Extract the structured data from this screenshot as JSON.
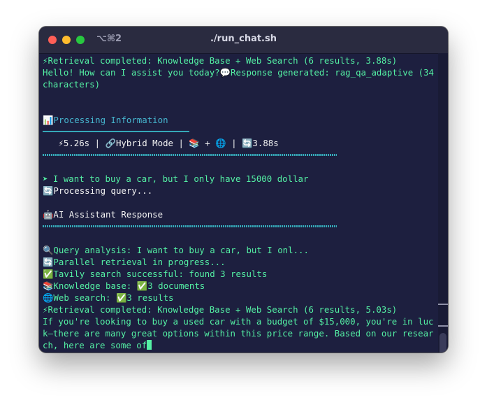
{
  "window": {
    "shortcut": "⌥⌘2",
    "title": "./run_chat.sh"
  },
  "terminal": {
    "line1": "⚡Retrieval completed: Knowledge Base + Web Search (6 results, 3.88s)",
    "line2": "Hello! How can I assist you today?💬Response generated: rag_qa_adaptive (34 characters)",
    "processing_header": "📊Processing Information",
    "stats_line": "   ⚡5.26s | 🔗Hybrid Mode | 📚 + 🌐 | 🔄3.88s",
    "prompt_line": "➤ I want to buy a car, but I only have 15000 dollar",
    "processing_query": "🔄Processing query...",
    "assistant_header": "🤖AI Assistant Response",
    "query_analysis": "🔍Query analysis: I want to buy a car, but I onl...",
    "parallel": "🔄Parallel retrieval in progress...",
    "tavily": "✅Tavily search successful: found 3 results",
    "kb": "📚Knowledge base: ✅3 documents",
    "web": "🌐Web search: ✅3 results",
    "retrieval2": "⚡Retrieval completed: Knowledge Base + Web Search (6 results, 5.03s)",
    "response": "If you're looking to buy a used car with a budget of $15,000, you're in luck—there are many great options within this price range. Based on our research, here are some of"
  },
  "colors": {
    "terminal_bg": "#1d1f3f",
    "text_green": "#54f0a4",
    "info_blue": "#46b6cf",
    "white": "#f2f2f2"
  }
}
